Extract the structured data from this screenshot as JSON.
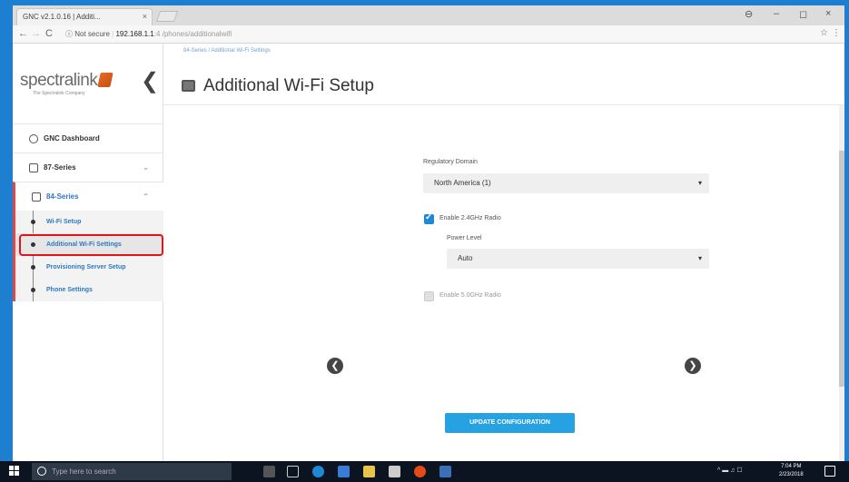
{
  "browser": {
    "tab_title": "GNC v2.1.0.16 | Additi...",
    "tab_close": "×",
    "security_label": "Not secure",
    "url_host": "192.168.1.1",
    "url_path": ":4 /phones/additionalwifi",
    "back": "←",
    "forward": "→",
    "reload": "C",
    "info_icon": "ⓘ",
    "star": "☆",
    "menu": "⋮",
    "profile": "⊖",
    "minimize": "–",
    "maximize": "◻",
    "close": "×"
  },
  "sidebar": {
    "logo_text": "spectralink",
    "logo_sub": "The Spectralink Company",
    "collapse": "❮",
    "items": [
      {
        "label": "GNC Dashboard"
      },
      {
        "label": "87-Series",
        "chevron": "⌄"
      },
      {
        "label": "84-Series",
        "chevron": "⌃"
      }
    ],
    "sub_items": [
      {
        "label": "Wi-Fi Setup"
      },
      {
        "label": "Additional Wi-Fi Settings"
      },
      {
        "label": "Provisioning Server Setup"
      },
      {
        "label": "Phone Settings"
      }
    ]
  },
  "header": {
    "breadcrumb": "84-Series / Additional Wi-Fi Settings",
    "title": "Additional Wi-Fi Setup"
  },
  "form": {
    "regulatory_label": "Regulatory Domain",
    "regulatory_value": "North America (1)",
    "enable_24_label": "Enable 2.4GHz Radio",
    "enable_24_checked": true,
    "power_label": "Power Level",
    "power_value": "Auto",
    "enable_5_label": "Enable 5.0GHz Radio",
    "enable_5_checked": false,
    "caret": "▾",
    "update_button": "UPDATE CONFIGURATION"
  },
  "nav_arrows": {
    "prev": "❮",
    "next": "❯"
  },
  "taskbar": {
    "search_placeholder": "Type here to search",
    "time": "7:04 PM",
    "date": "2/23/2018",
    "tray_icons": "^  ▬  ♫  ☐"
  },
  "colors": {
    "accent": "#2e79c0",
    "highlight_red": "#e0151b",
    "button_blue": "#26a2e3"
  }
}
